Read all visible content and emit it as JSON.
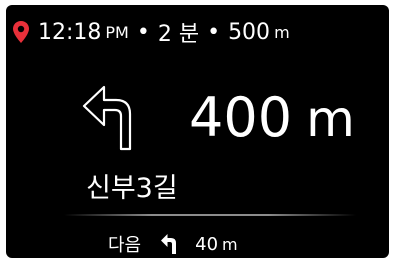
{
  "status_bar": {
    "time": "12:18",
    "ampm": "PM",
    "separator": "•",
    "duration": "2 분",
    "distance_value": "500",
    "distance_unit": "m",
    "pin_color": "#e8303a"
  },
  "maneuver": {
    "icon": "turn-left-arrow-icon",
    "distance_value": "400",
    "distance_unit": "m",
    "street": "신부3길"
  },
  "next": {
    "label": "다음",
    "icon": "turn-left-arrow-icon",
    "distance_value": "40",
    "distance_unit": "m"
  }
}
